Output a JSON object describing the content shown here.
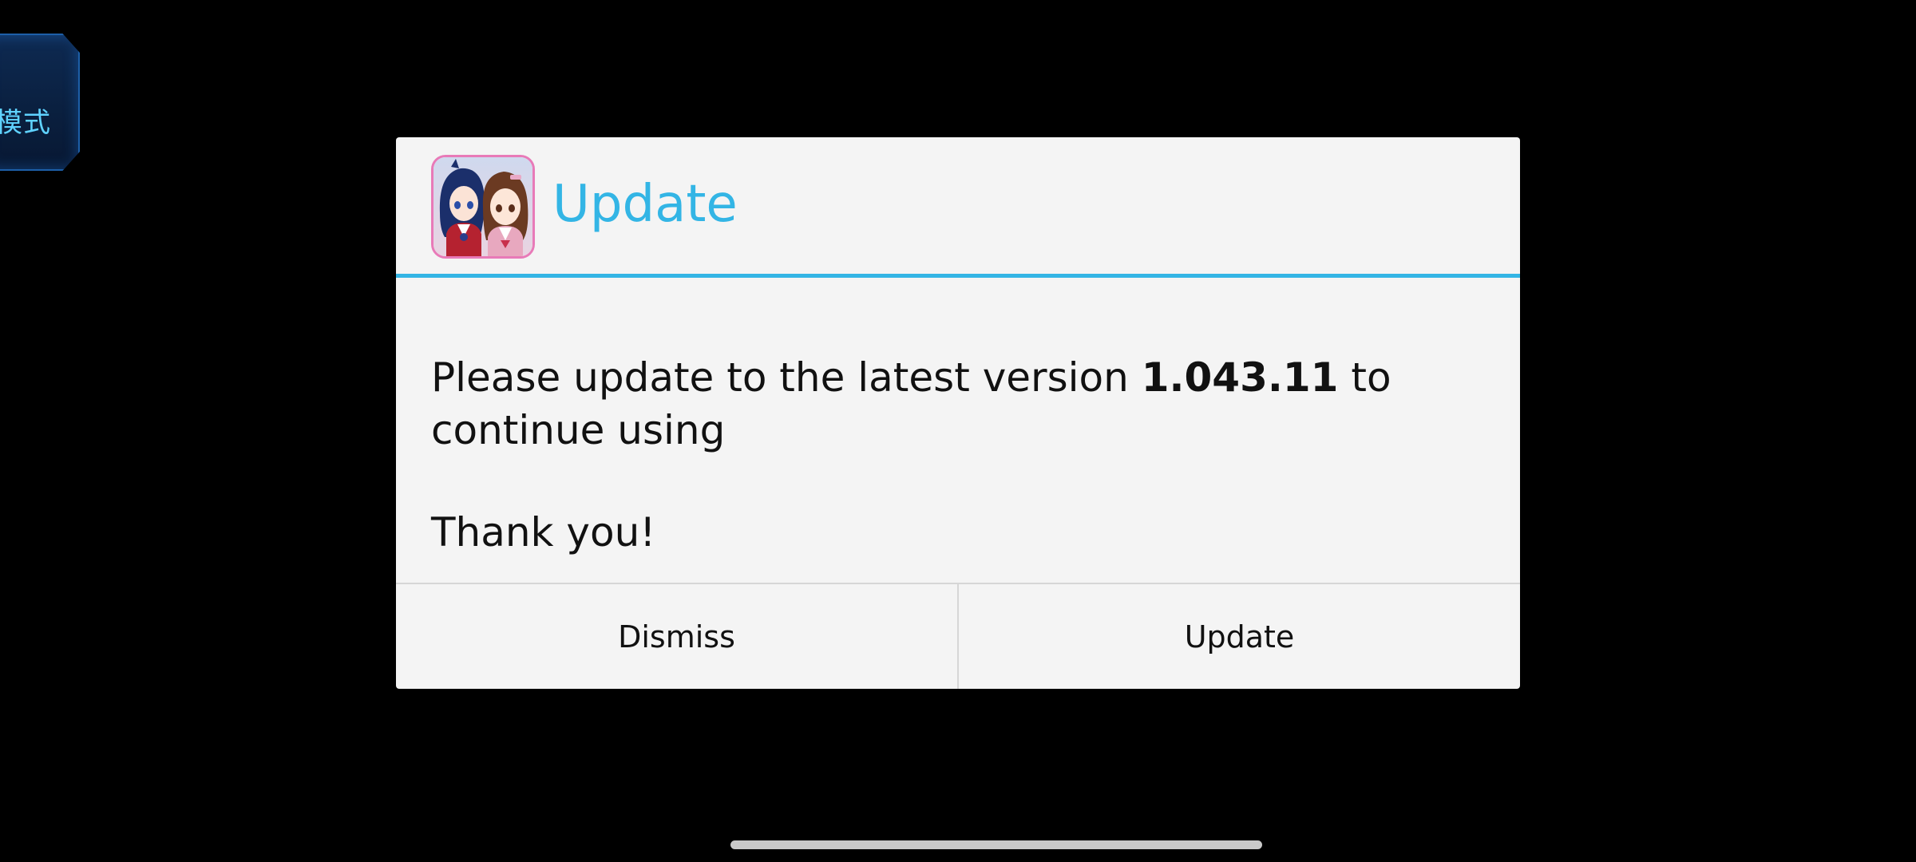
{
  "side_button": {
    "label": "模式",
    "icon": "mode-panel-icon",
    "accent": "#5fd2ff"
  },
  "dialog": {
    "title": "Update",
    "app_icon": "app-icon-two-anime-characters",
    "message_before": "Please update to the latest version ",
    "version": "1.043.11",
    "message_after": " to continue using",
    "thanks": "Thank you!",
    "buttons": {
      "dismiss": "Dismiss",
      "update": "Update"
    },
    "accent_color": "#33b5e5",
    "background": "#f4f4f4"
  },
  "system": {
    "home_indicator": "home-indicator-bar"
  }
}
